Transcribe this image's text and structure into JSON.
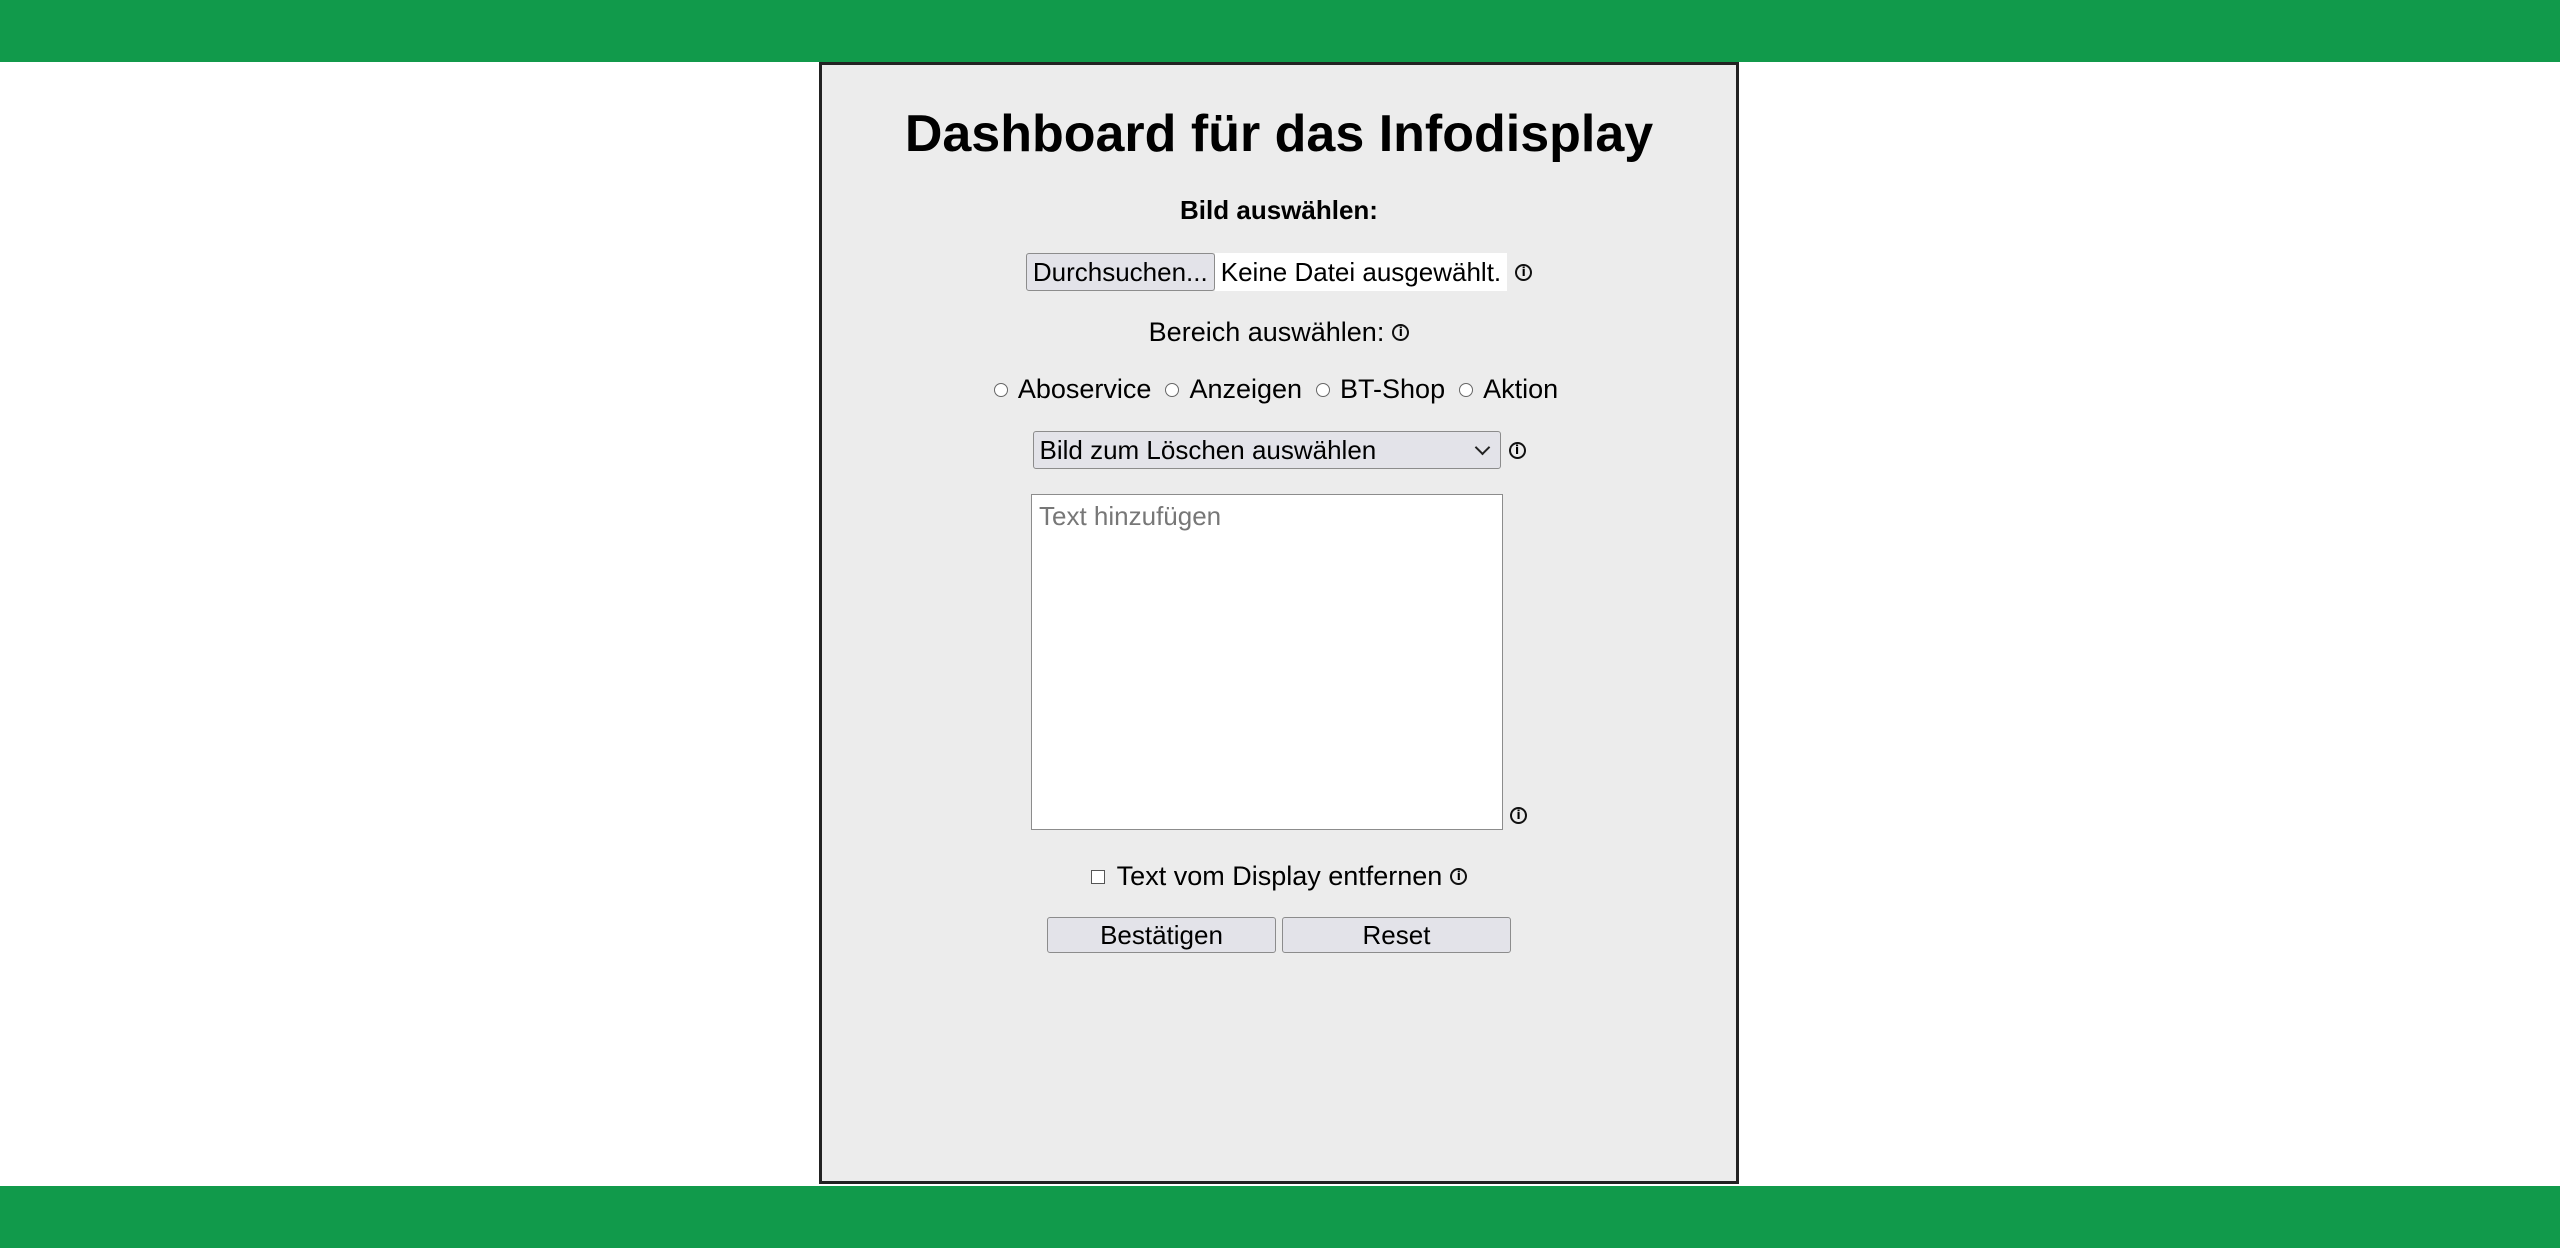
{
  "header": {},
  "dashboard": {
    "title": "Dashboard für das Infodisplay",
    "image_label": "Bild auswählen:",
    "file_button_label": "Durchsuchen...",
    "file_status": "Keine Datei ausgewählt.",
    "area_label": "Bereich auswählen:",
    "areas": [
      "Aboservice",
      "Anzeigen",
      "BT-Shop",
      "Aktion"
    ],
    "delete_select_value": "Bild zum Löschen auswählen",
    "text_placeholder": "Text hinzufügen",
    "remove_text_label": "Text vom Display entfernen",
    "confirm_label": "Bestätigen",
    "reset_label": "Reset",
    "info_icon_glyph": "i"
  },
  "colors": {
    "bar_green": "#119a4b",
    "panel_bg": "#ececec"
  }
}
